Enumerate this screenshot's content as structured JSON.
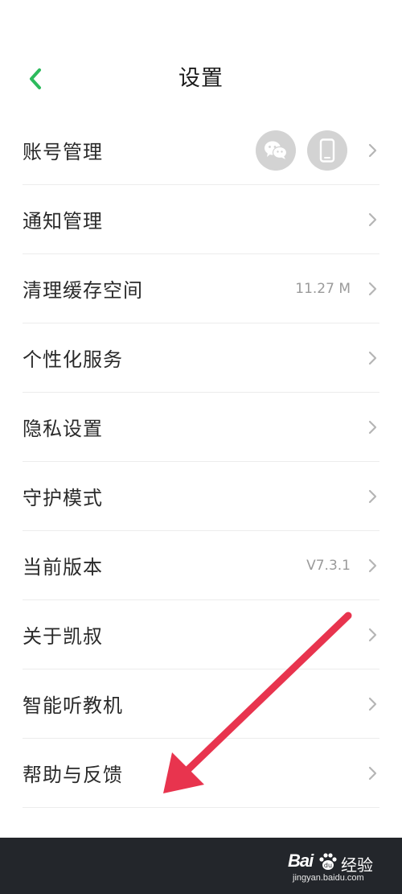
{
  "header": {
    "title": "设置",
    "back_icon": "chevron-left-icon",
    "accent_color": "#2dbb5d"
  },
  "settings": {
    "items": [
      {
        "label": "账号管理",
        "value": "",
        "bound_accounts": [
          "wechat-icon",
          "phone-icon"
        ]
      },
      {
        "label": "通知管理",
        "value": ""
      },
      {
        "label": "清理缓存空间",
        "value": "11.27 M"
      },
      {
        "label": "个性化服务",
        "value": ""
      },
      {
        "label": "隐私设置",
        "value": ""
      },
      {
        "label": "守护模式",
        "value": ""
      },
      {
        "label": "当前版本",
        "value": "V7.3.1"
      },
      {
        "label": "关于凯叔",
        "value": ""
      },
      {
        "label": "智能听教机",
        "value": ""
      },
      {
        "label": "帮助与反馈",
        "value": ""
      }
    ]
  },
  "annotation": {
    "color": "#e8344e"
  },
  "watermark": {
    "brand": "Bai",
    "brand_cn": "经验",
    "url": "jingyan.baidu.com"
  }
}
